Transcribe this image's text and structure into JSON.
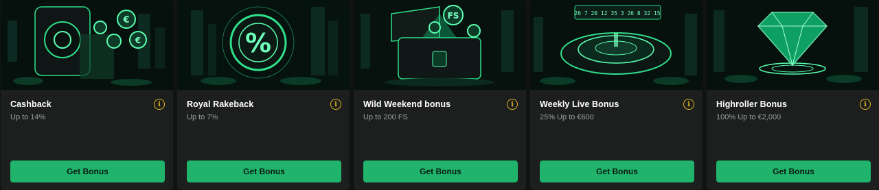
{
  "cards": [
    {
      "title": "Cashback",
      "subtitle": "Up to 14%",
      "button": "Get Bonus",
      "icon": "vault-coins-icon"
    },
    {
      "title": "Royal Rakeback",
      "subtitle": "Up to 7%",
      "button": "Get Bonus",
      "icon": "percent-chip-icon"
    },
    {
      "title": "Wild Weekend bonus",
      "subtitle": "Up to 200 FS",
      "button": "Get Bonus",
      "icon": "treasure-chest-icon"
    },
    {
      "title": "Weekly Live Bonus",
      "subtitle": "25% Up to €600",
      "button": "Get Bonus",
      "icon": "roulette-icon"
    },
    {
      "title": "Highroller Bonus",
      "subtitle": "100% Up to €2,000",
      "button": "Get Bonus",
      "icon": "diamond-icon"
    }
  ],
  "art_labels": {
    "coin_symbol": "€",
    "percent_symbol": "%",
    "free_spins_symbol": "FS",
    "roulette_numbers": "26 7 20 12 35 3 26 8 32 15"
  },
  "info_glyph": "i",
  "colors": {
    "accent": "#1fb36b",
    "card_bg": "#1d1f1e",
    "info": "#e2b51f",
    "glow": "#3dffa0"
  }
}
